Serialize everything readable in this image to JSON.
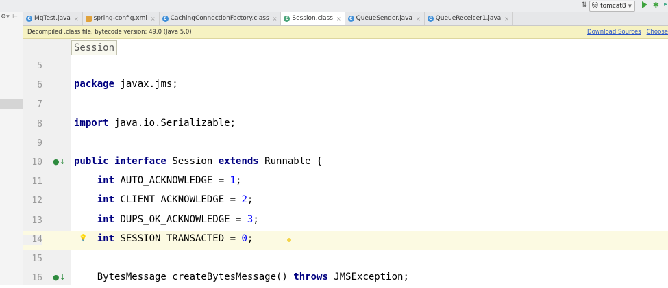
{
  "toolbar": {
    "run_config": "tomcat8"
  },
  "tabs": [
    {
      "label": "MqTest.java",
      "icon": "c",
      "active": false
    },
    {
      "label": "spring-config.xml",
      "icon": "x",
      "active": false
    },
    {
      "label": "CachingConnectionFactory.class",
      "icon": "c",
      "active": false
    },
    {
      "label": "Session.class",
      "icon": "ci",
      "active": true
    },
    {
      "label": "QueueSender.java",
      "icon": "c",
      "active": false
    },
    {
      "label": "QueueReceicer1.java",
      "icon": "c",
      "active": false
    }
  ],
  "banner": {
    "message": "Decompiled .class file, bytecode version: 49.0 (Java 5.0)",
    "download_sources": "Download Sources",
    "choose_sources": "Choose"
  },
  "breadcrumb": "Session",
  "lines": [
    {
      "num": "5",
      "code": [],
      "icon": "",
      "highlight": false
    },
    {
      "num": "6",
      "code": [
        {
          "t": "kw",
          "v": "package"
        },
        {
          "t": "txt",
          "v": " javax.jms;"
        }
      ],
      "icon": "",
      "highlight": false
    },
    {
      "num": "7",
      "code": [],
      "icon": "",
      "highlight": false
    },
    {
      "num": "8",
      "code": [
        {
          "t": "kw",
          "v": "import"
        },
        {
          "t": "txt",
          "v": " java.io.Serializable;"
        }
      ],
      "icon": "",
      "highlight": false
    },
    {
      "num": "9",
      "code": [],
      "icon": "",
      "highlight": false
    },
    {
      "num": "10",
      "code": [
        {
          "t": "kw",
          "v": "public interface"
        },
        {
          "t": "txt",
          "v": " Session "
        },
        {
          "t": "kw",
          "v": "extends"
        },
        {
          "t": "txt",
          "v": " Runnable {"
        }
      ],
      "icon": "implemented-icon",
      "highlight": false
    },
    {
      "num": "11",
      "code": [
        {
          "t": "txt",
          "v": "    "
        },
        {
          "t": "kw",
          "v": "int"
        },
        {
          "t": "txt",
          "v": " AUTO_ACKNOWLEDGE = "
        },
        {
          "t": "num",
          "v": "1"
        },
        {
          "t": "txt",
          "v": ";"
        }
      ],
      "icon": "",
      "highlight": false
    },
    {
      "num": "12",
      "code": [
        {
          "t": "txt",
          "v": "    "
        },
        {
          "t": "kw",
          "v": "int"
        },
        {
          "t": "txt",
          "v": " CLIENT_ACKNOWLEDGE = "
        },
        {
          "t": "num",
          "v": "2"
        },
        {
          "t": "txt",
          "v": ";"
        }
      ],
      "icon": "",
      "highlight": false
    },
    {
      "num": "13",
      "code": [
        {
          "t": "txt",
          "v": "    "
        },
        {
          "t": "kw",
          "v": "int"
        },
        {
          "t": "txt",
          "v": " DUPS_OK_ACKNOWLEDGE = "
        },
        {
          "t": "num",
          "v": "3"
        },
        {
          "t": "txt",
          "v": ";"
        }
      ],
      "icon": "",
      "highlight": false
    },
    {
      "num": "14",
      "code": [
        {
          "t": "txt",
          "v": "    "
        },
        {
          "t": "kw",
          "v": "int"
        },
        {
          "t": "txt",
          "v": " SESSION_TRANSACTED = "
        },
        {
          "t": "num",
          "v": "0"
        },
        {
          "t": "txt",
          "v": ";"
        }
      ],
      "icon": "lightbulb-icon",
      "highlight": true
    },
    {
      "num": "15",
      "code": [],
      "icon": "",
      "highlight": false
    },
    {
      "num": "16",
      "code": [
        {
          "t": "txt",
          "v": "    BytesMessage createBytesMessage() "
        },
        {
          "t": "kw",
          "v": "throws"
        },
        {
          "t": "txt",
          "v": " JMSException;"
        }
      ],
      "icon": "implemented-icon",
      "highlight": false
    }
  ]
}
